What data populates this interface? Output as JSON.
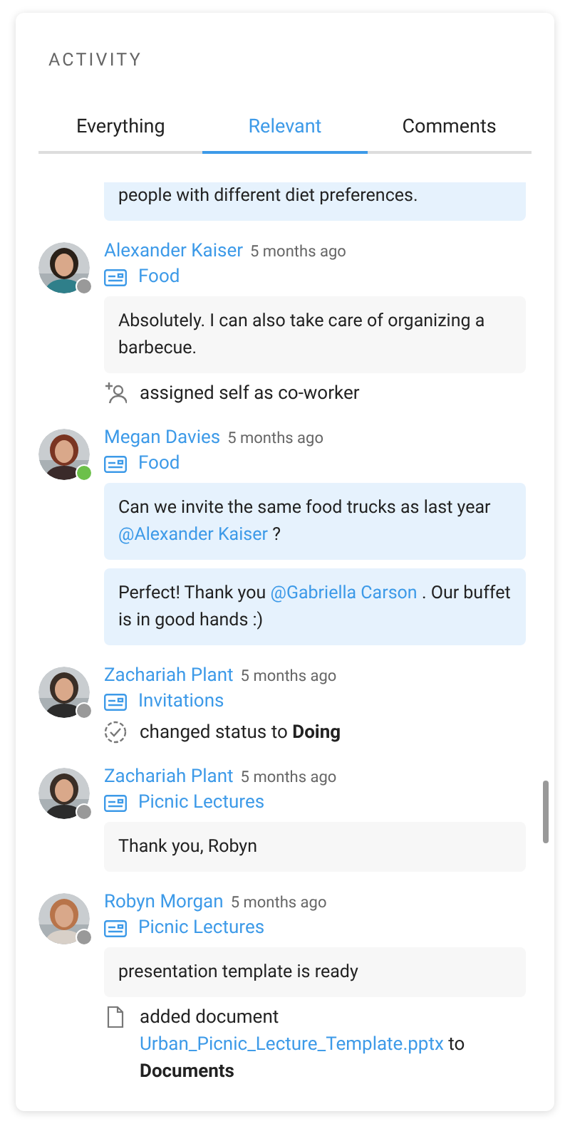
{
  "title": "ACTIVITY",
  "tabs": [
    {
      "label": "Everything",
      "selected": false
    },
    {
      "label": "Relevant",
      "selected": true
    },
    {
      "label": "Comments",
      "selected": false
    }
  ],
  "partial_comment": {
    "text": "people with different diet preferences.",
    "highlighted": true
  },
  "entries": [
    {
      "author": "Alexander Kaiser",
      "time": "5 months ago",
      "online": false,
      "card": "Food",
      "items": [
        {
          "kind": "comment",
          "highlighted": false,
          "parts": [
            {
              "kind": "text",
              "text": "Absolutely. I can also take care of organizing a barbecue."
            }
          ]
        },
        {
          "kind": "assignment",
          "parts": [
            {
              "kind": "text",
              "text": "assigned self as co-worker"
            }
          ]
        }
      ]
    },
    {
      "author": "Megan Davies",
      "time": "5 months ago",
      "online": true,
      "card": "Food",
      "items": [
        {
          "kind": "comment",
          "highlighted": true,
          "parts": [
            {
              "kind": "text",
              "text": "Can we invite the same food trucks as last year "
            },
            {
              "kind": "mention",
              "text": "@Alexander Kaiser"
            },
            {
              "kind": "text",
              "text": " ?"
            }
          ]
        },
        {
          "kind": "comment",
          "highlighted": true,
          "parts": [
            {
              "kind": "text",
              "text": "Perfect! Thank you "
            },
            {
              "kind": "mention",
              "text": "@Gabriella Carson"
            },
            {
              "kind": "text",
              "text": " . Our buffet is in good hands :)"
            }
          ]
        }
      ]
    },
    {
      "author": "Zachariah Plant",
      "time": "5 months ago",
      "online": false,
      "card": "Invitations",
      "items": [
        {
          "kind": "status",
          "parts": [
            {
              "kind": "text",
              "text": "changed status to "
            },
            {
              "kind": "bold",
              "text": "Doing"
            }
          ]
        }
      ]
    },
    {
      "author": "Zachariah Plant",
      "time": "5 months ago",
      "online": false,
      "card": "Picnic Lectures",
      "items": [
        {
          "kind": "comment",
          "highlighted": false,
          "parts": [
            {
              "kind": "text",
              "text": "Thank you, Robyn"
            }
          ]
        }
      ]
    },
    {
      "author": "Robyn Morgan",
      "time": "5 months ago",
      "online": false,
      "card": "Picnic Lectures",
      "items": [
        {
          "kind": "comment",
          "highlighted": false,
          "parts": [
            {
              "kind": "text",
              "text": "presentation template is ready"
            }
          ]
        },
        {
          "kind": "document",
          "parts": [
            {
              "kind": "text",
              "text": "added document "
            },
            {
              "kind": "link",
              "text": "Urban_Picnic_Lecture_Template.pptx"
            },
            {
              "kind": "text",
              "text": " to "
            },
            {
              "kind": "bold",
              "text": "Documents"
            }
          ]
        }
      ]
    }
  ]
}
